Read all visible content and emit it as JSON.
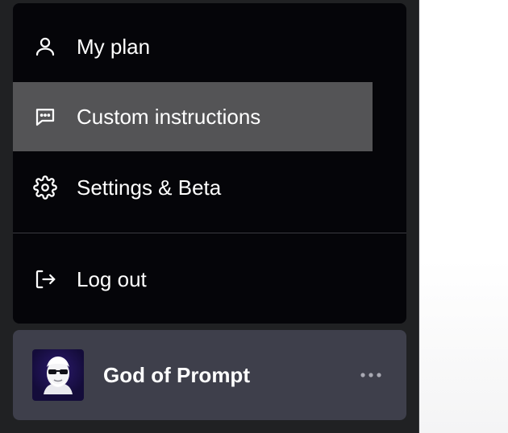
{
  "menu": {
    "items": [
      {
        "label": "My plan",
        "icon": "user-icon"
      },
      {
        "label": "Custom instructions",
        "icon": "message-dots-icon",
        "active": true
      },
      {
        "label": "Settings & Beta",
        "icon": "gear-icon"
      },
      {
        "label": "Log out",
        "icon": "logout-icon"
      }
    ]
  },
  "user": {
    "name": "God of Prompt",
    "avatar": "avatar-image"
  },
  "colors": {
    "sidebar": "#202123",
    "menu_bg": "#050509",
    "active_item": "#545456",
    "user_card": "#3e3f4b",
    "text": "#ffffff"
  }
}
